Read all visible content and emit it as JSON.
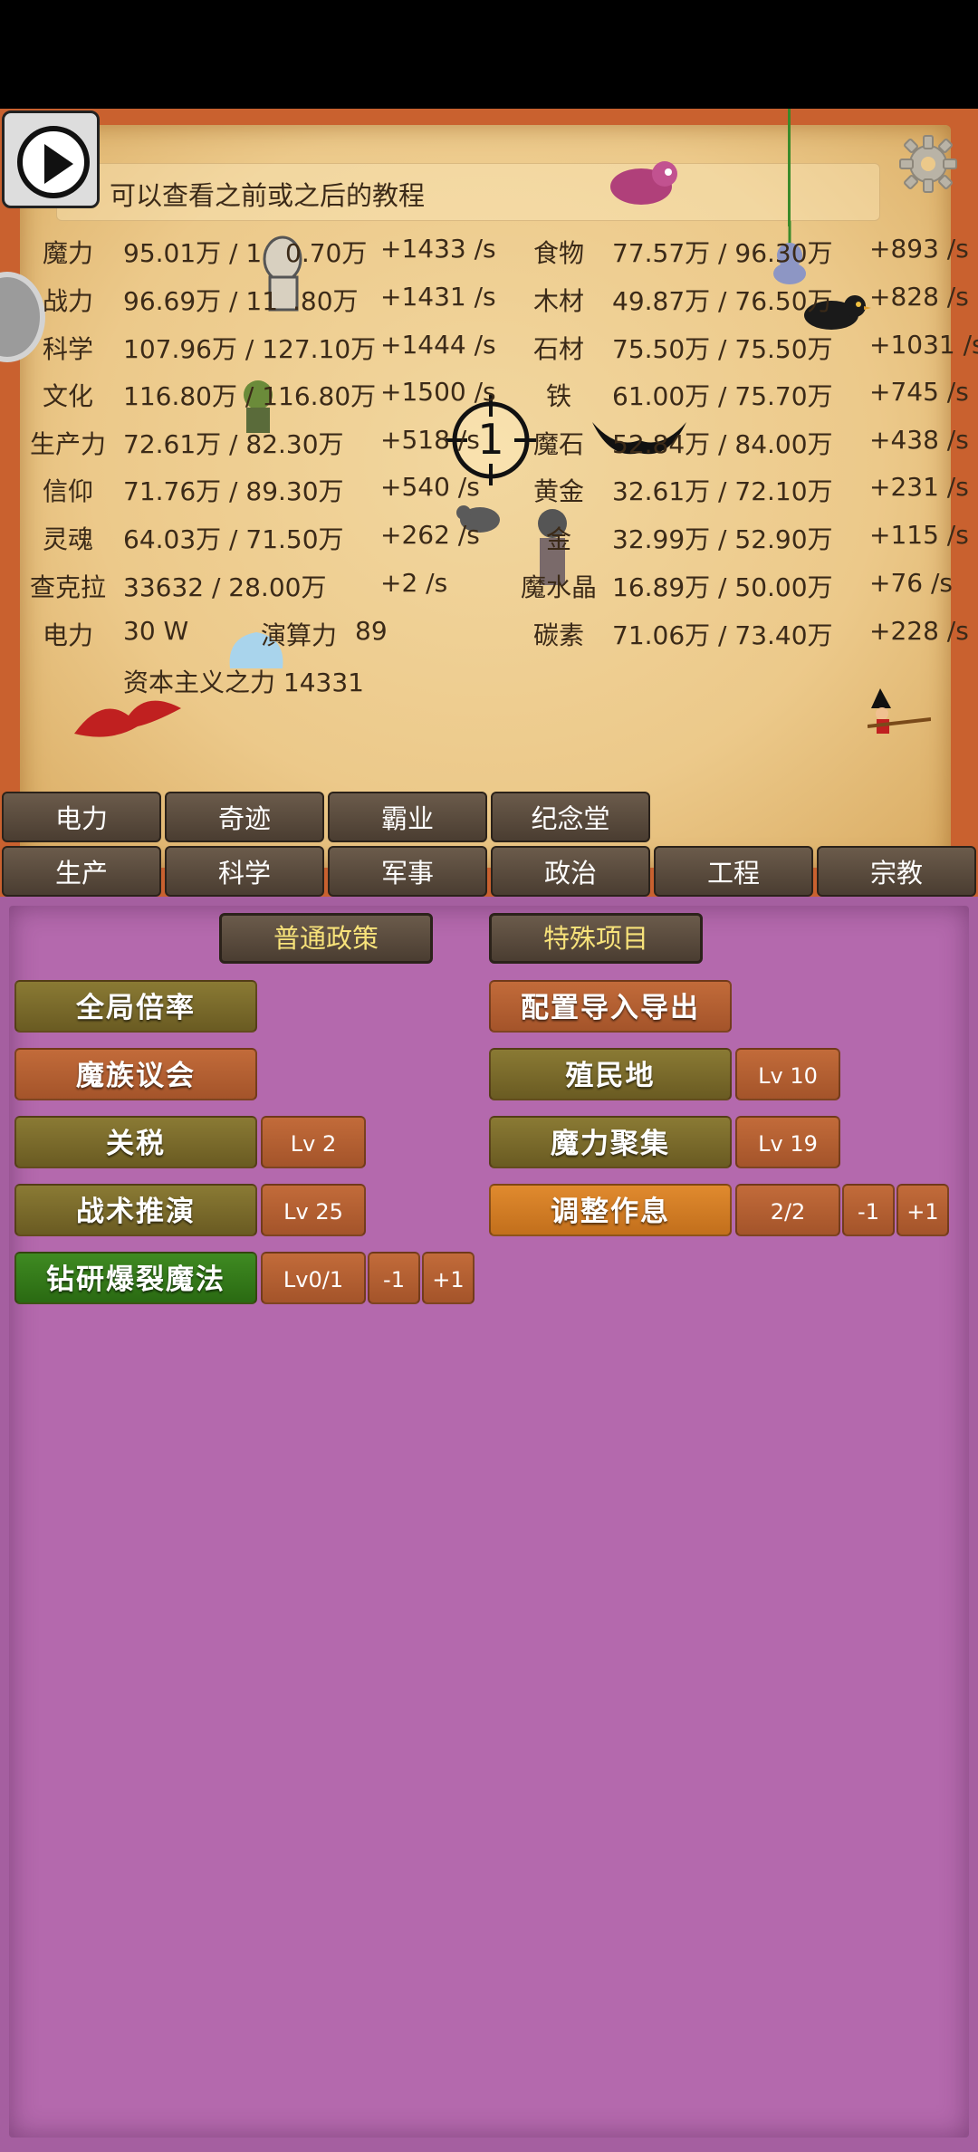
{
  "tutorial_text": "力，可以查看之前或之后的教程",
  "crosshair_number": "1",
  "resources_left": [
    {
      "label": "魔力",
      "value": "95.01万 / 1",
      "value2": "0.70万",
      "rate": "+1433 /s"
    },
    {
      "label": "战力",
      "value": "96.69万 / 11",
      "value2": ".80万",
      "rate": "+1431 /s"
    },
    {
      "label": "科学",
      "value": "107.96万 / 127.10万",
      "value2": "",
      "rate": "+1444 /s"
    },
    {
      "label": "文化",
      "value": "116.80万 / 116.80万",
      "value2": "",
      "rate": "+1500 /s"
    },
    {
      "label": "生产力",
      "value": "72.61万 / 82.30万",
      "value2": "",
      "rate": "+518 /s"
    },
    {
      "label": "信仰",
      "value": "71.76万 / 89.30万",
      "value2": "",
      "rate": "+540 /s"
    },
    {
      "label": "灵魂",
      "value": "64.03万 / 71.50万",
      "value2": "",
      "rate": "+262 /s"
    },
    {
      "label": "查克拉",
      "value": "33632 / 28.00万",
      "value2": "",
      "rate": "+2 /s"
    }
  ],
  "resources_right": [
    {
      "label": "食物",
      "value": "77.57万 / 96.30万",
      "rate": "+893 /s"
    },
    {
      "label": "木材",
      "value": "49.87万 / 76.50万",
      "rate": "+828 /s"
    },
    {
      "label": "石材",
      "value": "75.50万 / 75.50万",
      "rate": "+1031 /s"
    },
    {
      "label": "铁",
      "value": "61.00万 / 75.70万",
      "rate": "+745 /s"
    },
    {
      "label": "魔石",
      "value": "52.84万 / 84.00万",
      "rate": "+438 /s"
    },
    {
      "label": "黄金",
      "value": "32.61万 / 72.10万",
      "rate": "+231 /s"
    },
    {
      "label": "金",
      "value": "32.99万 / 52.90万",
      "rate": "+115 /s"
    },
    {
      "label": "魔水晶",
      "value": "16.89万 / 50.00万",
      "rate": "+76 /s"
    },
    {
      "label": "碳素",
      "value": "71.06万 / 73.40万",
      "rate": "+228 /s"
    }
  ],
  "power": {
    "label": "电力",
    "value": "30 W",
    "compute_label": "演算力",
    "compute_value": "89"
  },
  "capitalism": "资本主义之力 14331",
  "tabs_row1": [
    "电力",
    "奇迹",
    "霸业",
    "纪念堂"
  ],
  "tabs_row2": [
    "生产",
    "科学",
    "军事",
    "政治",
    "工程",
    "宗教"
  ],
  "subtabs": [
    "普通政策",
    "特殊项目"
  ],
  "buttons": {
    "global_rate": "全局倍率",
    "config_io": "配置导入导出",
    "demon_council": "魔族议会",
    "colony": "殖民地",
    "colony_lv": "Lv 10",
    "tariff": "关税",
    "tariff_lv": "Lv 2",
    "mana_gather": "魔力聚集",
    "mana_gather_lv": "Lv 19",
    "tactics": "战术推演",
    "tactics_lv": "Lv 25",
    "adjust_rest": "调整作息",
    "adjust_rest_val": "2/2",
    "adjust_minus": "-1",
    "adjust_plus": "+1",
    "research_magic": "钻研爆裂魔法",
    "research_lv": "Lv0/1",
    "research_minus": "-1",
    "research_plus": "+1"
  }
}
